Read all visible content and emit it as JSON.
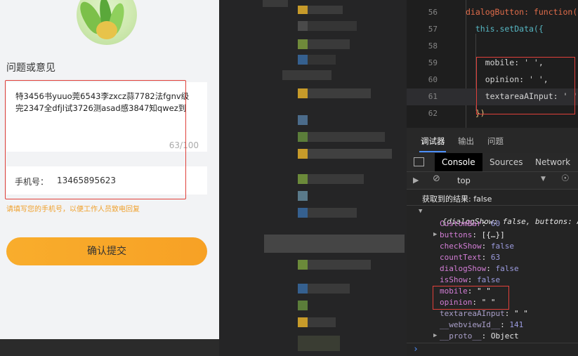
{
  "form": {
    "section_title": "问题或意见",
    "textarea_value": "特3456书yuuo莞6543李zxcz蒜7782法fgnv级完2347全dfjl试3726测asad感3847知qwez到",
    "counter": "63/100",
    "phone_label": "手机号：",
    "phone_value": "13465895623",
    "hint": "请填写您的手机号，以便工作人员致电回复",
    "submit_label": "确认提交"
  },
  "editor": {
    "lines": [
      {
        "num": "56",
        "code": "dialogButton: function() {"
      },
      {
        "num": "57",
        "code": "  this.setData({"
      },
      {
        "num": "58",
        "code": ""
      },
      {
        "num": "59",
        "code": "    mobile: ' ',"
      },
      {
        "num": "60",
        "code": "    opinion: ' ',"
      },
      {
        "num": "61",
        "code": "    textareaAInput: ' '"
      },
      {
        "num": "62",
        "code": "  })"
      }
    ]
  },
  "devtools": {
    "top_tabs": [
      "调试器",
      "输出",
      "问题"
    ],
    "panel_tabs": [
      "Console",
      "Sources",
      "Network"
    ],
    "context": "top",
    "log_text": "获取到的结果: false",
    "object_summary": "{dialogShow: false, buttons: Arr",
    "props": [
      {
        "key": "CustomBar",
        "value": "60"
      },
      {
        "key": "buttons",
        "value": "[{…}]"
      },
      {
        "key": "checkShow",
        "value": "false"
      },
      {
        "key": "countText",
        "value": "63"
      },
      {
        "key": "dialogShow",
        "value": "false"
      },
      {
        "key": "isShow",
        "value": "false"
      },
      {
        "key": "mobile",
        "value": "\" \""
      },
      {
        "key": "opinion",
        "value": "\" \""
      },
      {
        "key": "textareaAInput",
        "value": "\" \""
      },
      {
        "key": "__webviewId__",
        "value": "141"
      },
      {
        "key": "__proto__",
        "value": "Object"
      }
    ],
    "prompt": "›"
  }
}
